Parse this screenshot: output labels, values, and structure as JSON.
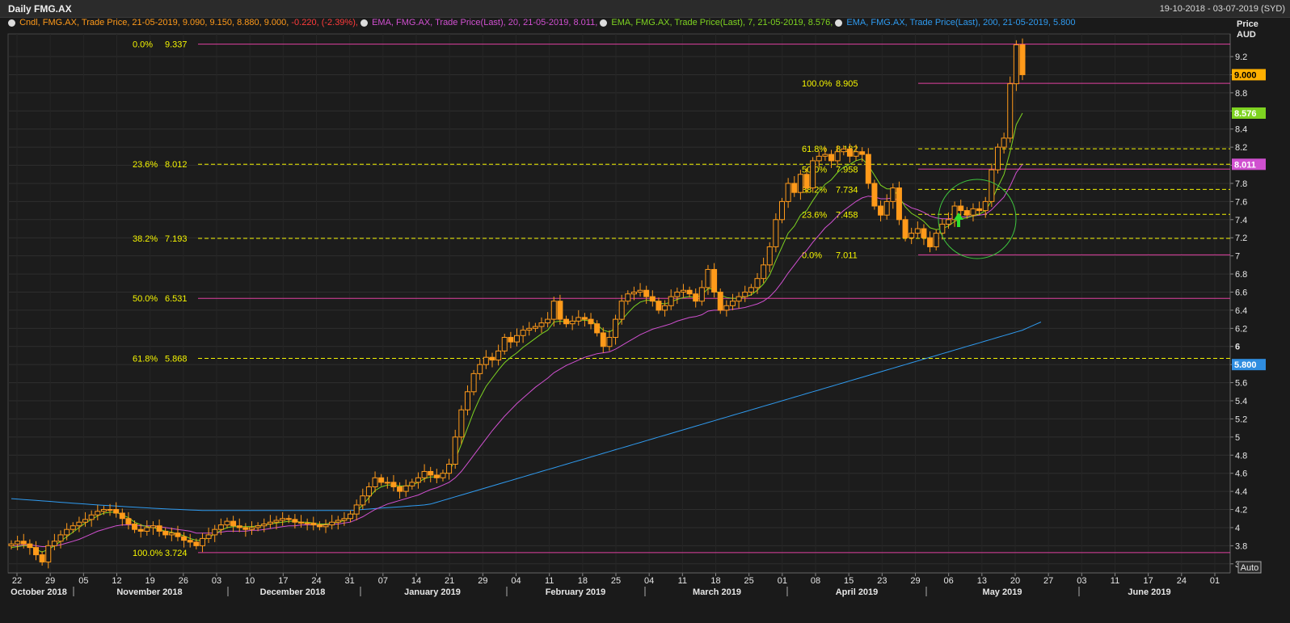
{
  "window": {
    "title": "Daily FMG.AX",
    "date_range": "19-10-2018 - 03-07-2019 (SYD)"
  },
  "legend": [
    {
      "text": "Cndl, FMG.AX, Trade Price,  21-05-2019, 9.090, 9.150, 8.880, 9.000,",
      "color": "#ff9a1a"
    },
    {
      "text": "-0.220, (-2.39%),",
      "color": "#ff3b3b"
    },
    {
      "text": "EMA, FMG.AX, Trade Price(Last),  20, 21-05-2019, 8.011,",
      "color": "#d050d0"
    },
    {
      "text": "EMA, FMG.AX, Trade Price(Last),  7, 21-05-2019, 8.576,",
      "color": "#7ed321"
    },
    {
      "text": "EMA, FMG.AX, Trade Price(Last),  200, 21-05-2019, 5.800",
      "color": "#2f9bf0"
    }
  ],
  "axis_header": {
    "line1": "Price",
    "line2": "AUD"
  },
  "auto_button": "Auto",
  "colors": {
    "background": "#1a1a1a",
    "candle_up": "#1a1a1a",
    "candle_down": "#ff9a1a",
    "ema20": "#d050d0",
    "ema7": "#7ed321",
    "ema200": "#2f9bf0",
    "fib_solid": "#e040a0",
    "fib_dash": "#f5f500",
    "fib_label": "#f5f500"
  },
  "chart_data": {
    "type": "candlestick",
    "ylim": [
      3.5,
      9.45
    ],
    "y_ticks": [
      "3.6",
      "3.8",
      "4",
      "4.2",
      "4.4",
      "4.6",
      "4.8",
      "5",
      "5.2",
      "5.4",
      "5.6",
      "5.8",
      "6",
      "6.2",
      "6.4",
      "6.6",
      "6.8",
      "7",
      "7.2",
      "7.4",
      "7.6",
      "7.8",
      "8",
      "8.2",
      "8.4",
      "8.6",
      "8.8",
      "9",
      "9.2"
    ],
    "x_day_labels": [
      "22",
      "29",
      "05",
      "12",
      "19",
      "26",
      "03",
      "10",
      "17",
      "24",
      "31",
      "07",
      "14",
      "21",
      "29",
      "04",
      "11",
      "18",
      "25",
      "04",
      "11",
      "18",
      "25",
      "01",
      "08",
      "15",
      "23",
      "29",
      "06",
      "13",
      "20",
      "27",
      "03",
      "11",
      "17",
      "24",
      "01"
    ],
    "x_month_labels": [
      "October 2018",
      "November 2018",
      "December 2018",
      "January 2019",
      "February 2019",
      "March 2019",
      "April 2019",
      "May 2019",
      "June 2019"
    ],
    "price_badges": [
      {
        "value": "9.000",
        "series": "Trade Price"
      },
      {
        "value": "8.576",
        "series": "EMA 7"
      },
      {
        "value": "8.011",
        "series": "EMA 20"
      },
      {
        "value": "5.800",
        "series": "EMA 200"
      }
    ],
    "closes": [
      3.82,
      3.85,
      3.82,
      3.78,
      3.7,
      3.62,
      3.8,
      3.85,
      3.92,
      3.98,
      4.02,
      4.06,
      4.09,
      4.14,
      4.18,
      4.2,
      4.2,
      4.16,
      4.1,
      4.04,
      3.98,
      3.96,
      4.0,
      4.02,
      3.96,
      3.92,
      3.94,
      3.9,
      3.86,
      3.84,
      3.8,
      3.88,
      3.92,
      3.98,
      4.03,
      4.07,
      4.02,
      4.0,
      3.98,
      4.0,
      4.02,
      4.04,
      4.06,
      4.08,
      4.1,
      4.09,
      4.06,
      4.05,
      4.05,
      4.03,
      4.01,
      4.03,
      4.06,
      4.08,
      4.1,
      4.15,
      4.25,
      4.35,
      4.45,
      4.55,
      4.5,
      4.5,
      4.45,
      4.4,
      4.46,
      4.5,
      4.55,
      4.62,
      4.58,
      4.55,
      4.6,
      4.7,
      5.0,
      5.3,
      5.5,
      5.7,
      5.8,
      5.88,
      5.85,
      5.95,
      6.1,
      6.05,
      6.12,
      6.18,
      6.2,
      6.22,
      6.26,
      6.3,
      6.5,
      6.3,
      6.25,
      6.28,
      6.32,
      6.3,
      6.25,
      6.15,
      6.0,
      6.1,
      6.3,
      6.5,
      6.58,
      6.6,
      6.62,
      6.55,
      6.5,
      6.4,
      6.45,
      6.55,
      6.6,
      6.62,
      6.58,
      6.5,
      6.65,
      6.85,
      6.6,
      6.4,
      6.45,
      6.5,
      6.55,
      6.6,
      6.65,
      6.75,
      6.9,
      7.1,
      7.4,
      7.6,
      7.8,
      7.7,
      7.9,
      7.75,
      8.05,
      8.1,
      8.12,
      8.05,
      8.15,
      8.18,
      8.1,
      8.15,
      8.12,
      7.8,
      7.55,
      7.45,
      7.6,
      7.75,
      7.4,
      7.2,
      7.25,
      7.3,
      7.2,
      7.1,
      7.25,
      7.35,
      7.4,
      7.55,
      7.5,
      7.45,
      7.52,
      7.5,
      7.6,
      7.95,
      8.2,
      8.3,
      8.9,
      9.33,
      9.0
    ],
    "ema7": [
      3.78,
      3.79,
      3.8,
      3.8,
      3.76,
      3.73,
      3.76,
      3.8,
      3.85,
      3.9,
      3.95,
      4.0,
      4.05,
      4.09,
      4.13,
      4.16,
      4.17,
      4.17,
      4.14,
      4.11,
      4.06,
      4.03,
      4.01,
      4.0,
      3.98,
      3.96,
      3.95,
      3.93,
      3.91,
      3.88,
      3.86,
      3.86,
      3.89,
      3.93,
      3.97,
      4.0,
      4.01,
      4.01,
      4.01,
      4.01,
      4.02,
      4.03,
      4.04,
      4.05,
      4.06,
      4.07,
      4.07,
      4.06,
      4.06,
      4.05,
      4.04,
      4.04,
      4.05,
      4.06,
      4.08,
      4.12,
      4.18,
      4.25,
      4.33,
      4.41,
      4.45,
      4.47,
      4.47,
      4.46,
      4.46,
      4.47,
      4.5,
      4.54,
      4.56,
      4.56,
      4.58,
      4.62,
      4.75,
      4.92,
      5.1,
      5.28,
      5.43,
      5.56,
      5.65,
      5.74,
      5.82,
      5.88,
      5.93,
      5.99,
      6.04,
      6.09,
      6.14,
      6.18,
      6.27,
      6.28,
      6.27,
      6.27,
      6.29,
      6.29,
      6.28,
      6.24,
      6.18,
      6.16,
      6.2,
      6.29,
      6.37,
      6.44,
      6.49,
      6.51,
      6.51,
      6.48,
      6.47,
      6.49,
      6.52,
      6.54,
      6.55,
      6.54,
      6.57,
      6.64,
      6.63,
      6.57,
      6.54,
      6.53,
      6.53,
      6.55,
      6.57,
      6.62,
      6.69,
      6.79,
      6.95,
      7.1,
      7.25,
      7.33,
      7.45,
      7.5,
      7.61,
      7.71,
      7.79,
      7.84,
      7.92,
      7.98,
      8.01,
      8.05,
      8.07,
      8.0,
      7.89,
      7.78,
      7.74,
      7.74,
      7.65,
      7.54,
      7.47,
      7.43,
      7.38,
      7.31,
      7.29,
      7.3,
      7.33,
      7.38,
      7.41,
      7.42,
      7.44,
      7.46,
      7.5,
      7.61,
      7.76,
      7.9,
      8.15,
      8.45,
      8.576
    ],
    "ema20": [
      3.8,
      3.8,
      3.81,
      3.81,
      3.8,
      3.79,
      3.79,
      3.8,
      3.81,
      3.83,
      3.85,
      3.87,
      3.9,
      3.93,
      3.96,
      3.98,
      4.0,
      4.02,
      4.03,
      4.03,
      4.03,
      4.02,
      4.02,
      4.02,
      4.01,
      4.0,
      3.99,
      3.98,
      3.97,
      3.96,
      3.94,
      3.94,
      3.94,
      3.94,
      3.95,
      3.96,
      3.96,
      3.96,
      3.96,
      3.97,
      3.97,
      3.98,
      3.99,
      4.0,
      4.01,
      4.02,
      4.02,
      4.03,
      4.03,
      4.03,
      4.03,
      4.03,
      4.04,
      4.04,
      4.05,
      4.06,
      4.09,
      4.12,
      4.16,
      4.2,
      4.23,
      4.26,
      4.28,
      4.3,
      4.32,
      4.34,
      4.36,
      4.39,
      4.42,
      4.44,
      4.47,
      4.5,
      4.55,
      4.62,
      4.71,
      4.8,
      4.89,
      4.98,
      5.07,
      5.15,
      5.23,
      5.3,
      5.37,
      5.43,
      5.49,
      5.55,
      5.6,
      5.65,
      5.71,
      5.75,
      5.79,
      5.82,
      5.85,
      5.88,
      5.9,
      5.92,
      5.93,
      5.94,
      5.97,
      6.01,
      6.05,
      6.09,
      6.13,
      6.16,
      6.19,
      6.21,
      6.23,
      6.25,
      6.28,
      6.3,
      6.32,
      6.33,
      6.35,
      6.39,
      6.4,
      6.4,
      6.4,
      6.41,
      6.42,
      6.43,
      6.45,
      6.47,
      6.5,
      6.55,
      6.62,
      6.71,
      6.81,
      6.9,
      6.99,
      7.06,
      7.15,
      7.23,
      7.31,
      7.37,
      7.44,
      7.5,
      7.55,
      7.6,
      7.64,
      7.66,
      7.65,
      7.63,
      7.63,
      7.64,
      7.61,
      7.57,
      7.53,
      7.51,
      7.48,
      7.44,
      7.42,
      7.41,
      7.41,
      7.42,
      7.43,
      7.43,
      7.44,
      7.45,
      7.46,
      7.51,
      7.58,
      7.65,
      7.77,
      7.92,
      8.011
    ],
    "ema200": [
      4.32,
      4.315,
      4.31,
      4.305,
      4.3,
      4.295,
      4.29,
      4.285,
      4.28,
      4.275,
      4.27,
      4.265,
      4.26,
      4.255,
      4.25,
      4.246,
      4.242,
      4.238,
      4.234,
      4.23,
      4.226,
      4.222,
      4.218,
      4.214,
      4.21,
      4.207,
      4.204,
      4.201,
      4.198,
      4.195,
      4.192,
      4.19,
      4.19,
      4.19,
      4.19,
      4.19,
      4.19,
      4.19,
      4.19,
      4.19,
      4.19,
      4.19,
      4.19,
      4.19,
      4.19,
      4.19,
      4.19,
      4.19,
      4.19,
      4.19,
      4.19,
      4.19,
      4.19,
      4.19,
      4.19,
      4.19,
      4.195,
      4.2,
      4.205,
      4.21,
      4.215,
      4.22,
      4.225,
      4.23,
      4.235,
      4.24,
      4.245,
      4.25,
      4.26,
      4.28,
      4.3,
      4.32,
      4.34,
      4.36,
      4.38,
      4.4,
      4.42,
      4.44,
      4.46,
      4.48,
      4.5,
      4.52,
      4.54,
      4.56,
      4.58,
      4.6,
      4.62,
      4.64,
      4.66,
      4.68,
      4.7,
      4.72,
      4.74,
      4.76,
      4.78,
      4.8,
      4.82,
      4.84,
      4.86,
      4.88,
      4.9,
      4.92,
      4.94,
      4.96,
      4.98,
      5.0,
      5.02,
      5.04,
      5.06,
      5.08,
      5.1,
      5.12,
      5.14,
      5.16,
      5.18,
      5.2,
      5.22,
      5.24,
      5.26,
      5.28,
      5.3,
      5.32,
      5.34,
      5.36,
      5.38,
      5.4,
      5.42,
      5.44,
      5.46,
      5.48,
      5.5,
      5.52,
      5.54,
      5.56,
      5.58,
      5.6,
      5.62,
      5.64,
      5.66,
      5.68,
      5.7,
      5.72,
      5.74,
      5.76,
      5.78,
      5.8,
      5.82,
      5.84,
      5.86,
      5.88,
      5.9,
      5.92,
      5.94,
      5.96,
      5.98,
      6.0,
      6.02,
      6.04,
      6.06,
      6.08,
      6.1,
      6.12,
      6.14,
      6.16,
      6.18,
      6.21,
      6.24,
      6.27,
      5.8
    ],
    "fib_left": [
      {
        "pct": "0.0%",
        "value": "9.337",
        "price": 9.337,
        "style": "solid"
      },
      {
        "pct": "23.6%",
        "value": "8.012",
        "price": 8.012,
        "style": "dash"
      },
      {
        "pct": "38.2%",
        "value": "7.193",
        "price": 7.193,
        "style": "dash"
      },
      {
        "pct": "50.0%",
        "value": "6.531",
        "price": 6.531,
        "style": "solid"
      },
      {
        "pct": "61.8%",
        "value": "5.868",
        "price": 5.868,
        "style": "dash"
      },
      {
        "pct": "100.0%",
        "value": "3.724",
        "price": 3.724,
        "style": "solid"
      }
    ],
    "fib_right": [
      {
        "pct": "100.0%",
        "value": "8.905",
        "price": 8.905,
        "style": "solid"
      },
      {
        "pct": "61.8%",
        "value": "8.182",
        "price": 8.182,
        "style": "dash"
      },
      {
        "pct": "50.0%",
        "value": "7.958",
        "price": 7.958,
        "style": "solid"
      },
      {
        "pct": "38.2%",
        "value": "7.734",
        "price": 7.734,
        "style": "dash"
      },
      {
        "pct": "23.6%",
        "value": "7.458",
        "price": 7.458,
        "style": "dash"
      },
      {
        "pct": "0.0%",
        "value": "7.011",
        "price": 7.011,
        "style": "solid"
      }
    ]
  }
}
